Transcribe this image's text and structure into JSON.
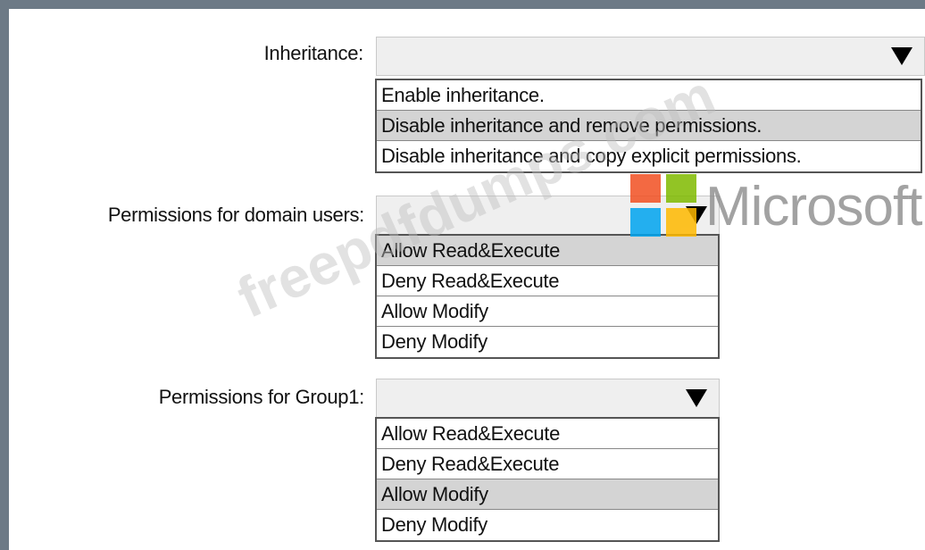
{
  "watermark": {
    "text": "freepdfdumps.com",
    "brand": "Microsoft",
    "colors": [
      "#f25022",
      "#7fba00",
      "#00a4ef",
      "#ffb900"
    ]
  },
  "fields": [
    {
      "label": "Inheritance:",
      "options": [
        "Enable inheritance.",
        "Disable inheritance and remove permissions.",
        "Disable inheritance and copy explicit permissions."
      ],
      "highlighted_index": 1
    },
    {
      "label": "Permissions for domain users:",
      "options": [
        "Allow Read&Execute",
        "Deny Read&Execute",
        "Allow Modify",
        "Deny Modify"
      ],
      "highlighted_index": 0
    },
    {
      "label": "Permissions for Group1:",
      "options": [
        "Allow Read&Execute",
        "Deny Read&Execute",
        "Allow Modify",
        "Deny Modify"
      ],
      "highlighted_index": 2
    }
  ]
}
